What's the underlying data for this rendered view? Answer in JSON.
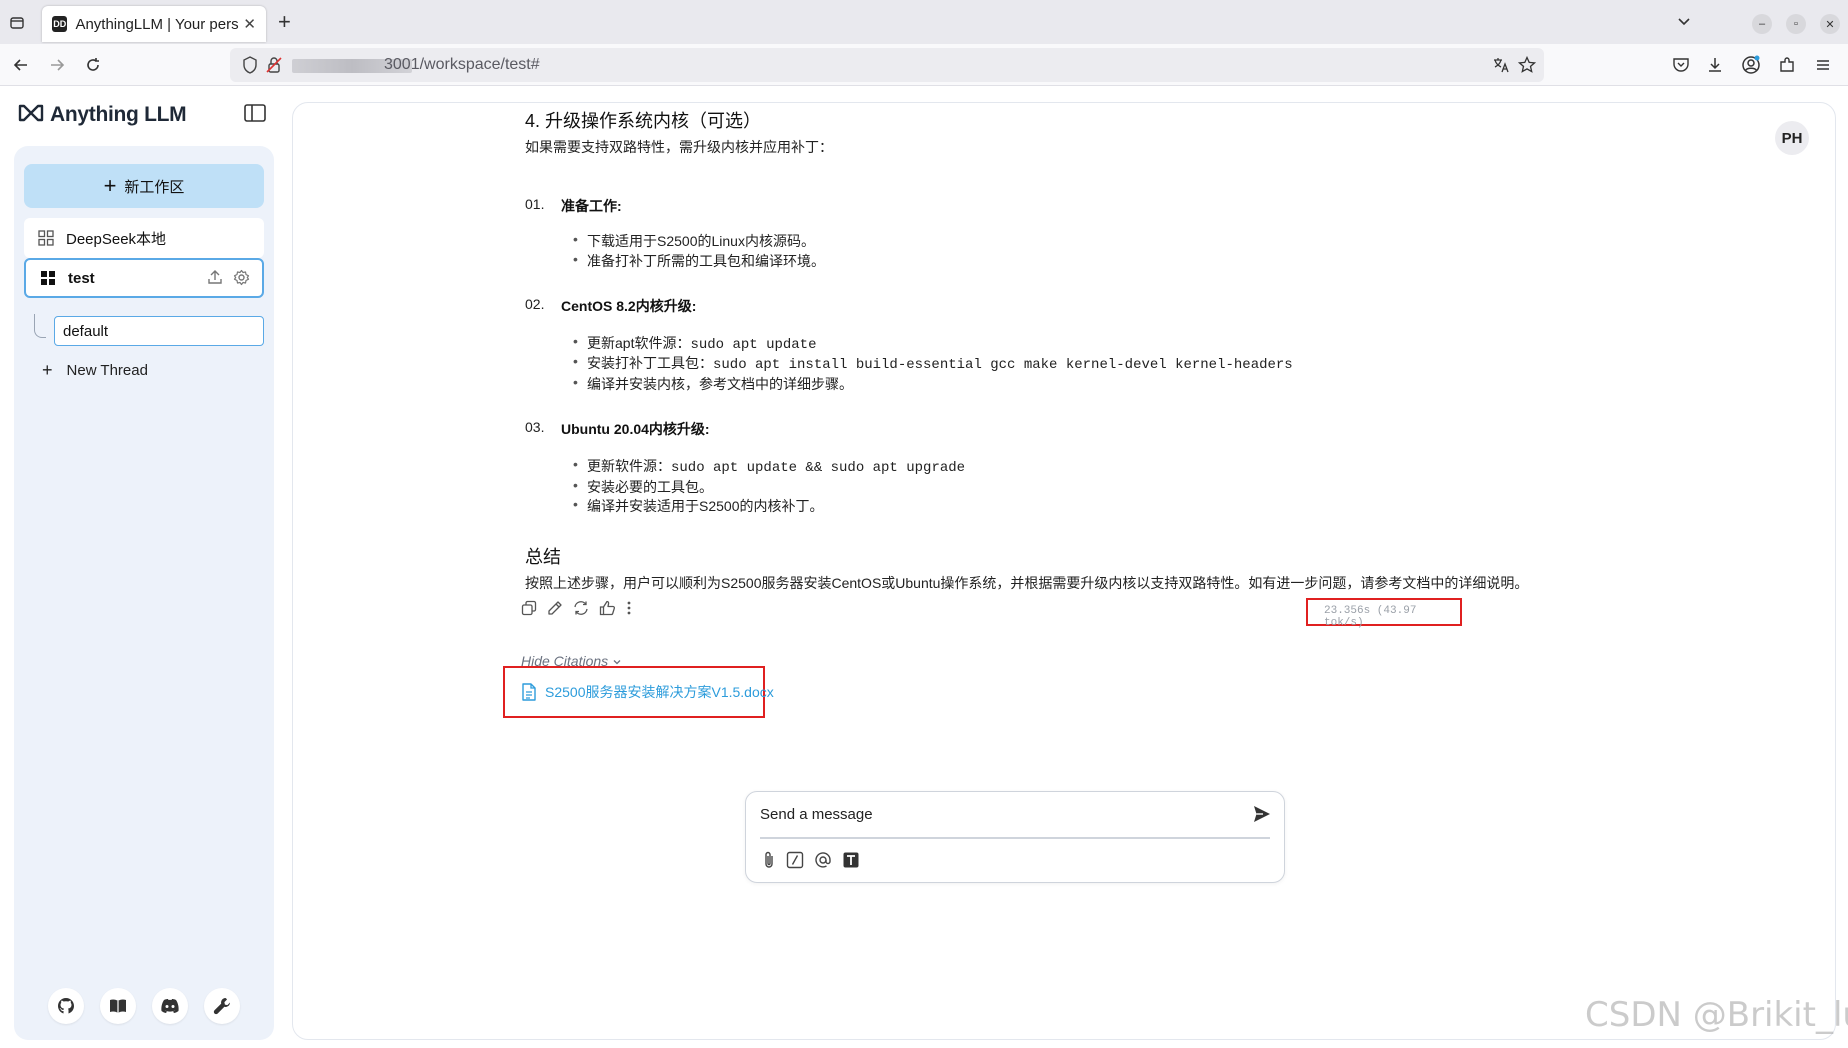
{
  "browser": {
    "tab_title": "AnythingLLM | Your personal LLM",
    "tab_favicon": "DD",
    "url_visible": "3001/workspace/test#"
  },
  "sidebar": {
    "brand": "Anything LLM",
    "new_workspace_label": "新工作区",
    "workspaces": [
      {
        "name": "DeepSeek本地",
        "active": false
      },
      {
        "name": "test",
        "active": true
      }
    ],
    "threads": [
      {
        "name": "default"
      }
    ],
    "new_thread_label": "New Thread",
    "footer_icons": [
      "github-icon",
      "book-icon",
      "discord-icon",
      "wrench-icon"
    ]
  },
  "header": {
    "avatar_initials": "PH"
  },
  "message": {
    "section4_title": "4. 升级操作系统内核（可选）",
    "section4_intro": "如果需要支持双路特性，需升级内核并应用补丁：",
    "steps": [
      {
        "num": "01.",
        "title": "准备工作",
        "bullets": [
          {
            "pre": "下载适用于S2500的Linux内核源码。",
            "code": ""
          },
          {
            "pre": "准备打补丁所需的工具包和编译环境。",
            "code": ""
          }
        ]
      },
      {
        "num": "02.",
        "title": "CentOS 8.2内核升级",
        "bullets": [
          {
            "pre": "更新apt软件源：",
            "code": "sudo apt update"
          },
          {
            "pre": "安装打补丁工具包：",
            "code": "sudo apt install build-essential gcc make kernel-devel kernel-headers"
          },
          {
            "pre": "编译并安装内核，参考文档中的详细步骤。",
            "code": ""
          }
        ]
      },
      {
        "num": "03.",
        "title": "Ubuntu 20.04内核升级",
        "bullets": [
          {
            "pre": "更新软件源：",
            "code": "sudo apt update && sudo apt upgrade"
          },
          {
            "pre": "安装必要的工具包。",
            "code": ""
          },
          {
            "pre": "编译并安装适用于S2500的内核补丁。",
            "code": ""
          }
        ]
      }
    ],
    "summary_title": "总结",
    "summary_text": "按照上述步骤，用户可以顺利为S2500服务器安装CentOS或Ubuntu操作系统，并根据需要升级内核以支持双路特性。如有进一步问题，请参考文档中的详细说明。",
    "timing": "23.356s (43.97 tok/s)",
    "hide_citations_label": "Hide Citations",
    "citation_file": "S2500服务器安装解决方案V1.5.docx"
  },
  "composer": {
    "placeholder": "Send a message"
  },
  "watermark": "CSDN @Brikit_lu",
  "colors": {
    "accent": "#5aa9e6",
    "new_ws_bg": "#bfe0f7",
    "highlight_red": "#e02020",
    "citation_link": "#2d9cdb"
  }
}
